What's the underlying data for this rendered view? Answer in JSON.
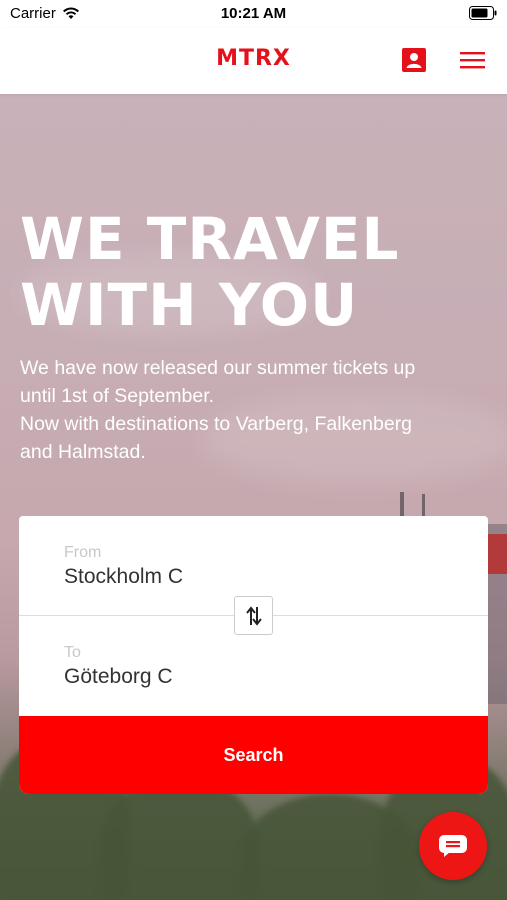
{
  "status_bar": {
    "carrier": "Carrier",
    "time": "10:21 AM"
  },
  "nav": {
    "logo": "MTRX",
    "profile_icon": "profile-icon",
    "menu_icon": "hamburger-menu-icon"
  },
  "hero": {
    "headline_line1": "WE TRAVEL",
    "headline_line2": "WITH YOU",
    "subtext_line1": "We have now released our summer tickets up",
    "subtext_line2": "until 1st of September.",
    "subtext_line3": "Now with destinations to Varberg, Falkenberg",
    "subtext_line4": "and Halmstad."
  },
  "booking": {
    "from_label": "From",
    "from_value": "Stockholm C",
    "to_label": "To",
    "to_value": "Göteborg C",
    "swap_icon": "swap-arrows-icon",
    "search_label": "Search"
  },
  "chat": {
    "icon": "chat-icon"
  },
  "colors": {
    "brand": "#e4111b",
    "search_button": "#ff0000",
    "chat_button": "#ee1515"
  }
}
